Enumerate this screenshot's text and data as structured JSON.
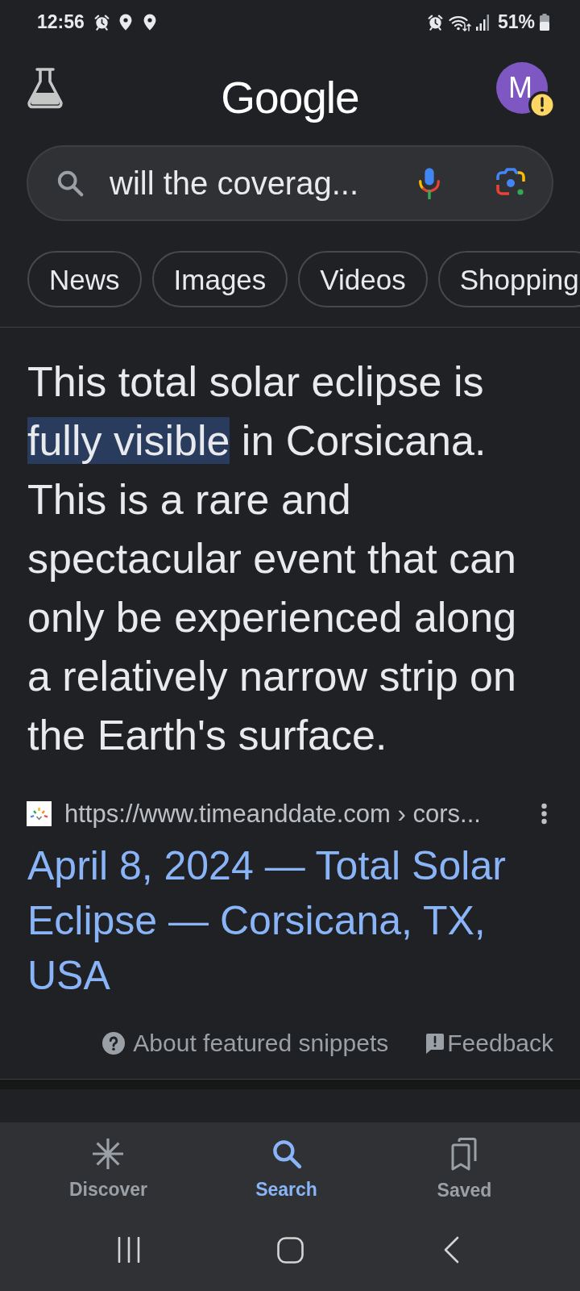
{
  "status_bar": {
    "time": "12:56",
    "battery": "51%"
  },
  "header": {
    "logo": "Google",
    "avatar": {
      "initial": "M",
      "warning": true
    }
  },
  "search": {
    "value": "will the coverag..."
  },
  "chips": [
    {
      "label": "News"
    },
    {
      "label": "Images"
    },
    {
      "label": "Videos"
    },
    {
      "label": "Shopping"
    }
  ],
  "snippet": {
    "segments": [
      {
        "text": "This total solar eclipse is ",
        "highlighted": false
      },
      {
        "text": "fully visible",
        "highlighted": true
      },
      {
        "text": " in Corsicana. This is a rare and spectacular event that can only be experienced along a relatively narrow strip on the Earth's surface.",
        "highlighted": false
      }
    ]
  },
  "result": {
    "url": "https://www.timeanddate.com › cors...",
    "title": "April 8, 2024 — Total Solar Eclipse — Corsicana, TX, USA"
  },
  "footer_links": [
    {
      "kind": "help",
      "label": "About featured snippets"
    },
    {
      "kind": "feedback",
      "label": "Feedback"
    }
  ],
  "bottom_nav": [
    {
      "kind": "discover",
      "label": "Discover",
      "selected": false
    },
    {
      "kind": "search",
      "label": "Search",
      "selected": true
    },
    {
      "kind": "saved",
      "label": "Saved",
      "selected": false
    }
  ]
}
